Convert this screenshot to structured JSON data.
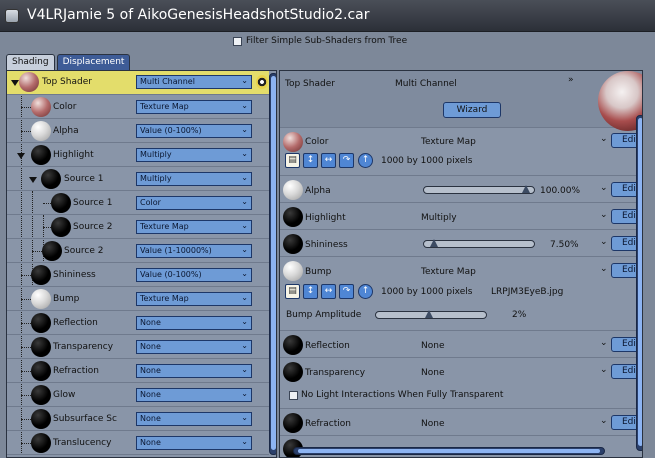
{
  "window": {
    "title": "V4LRJamie 5 of AikoGenesisHeadshotStudio2.car"
  },
  "filter": {
    "label": "Filter Simple Sub-Shaders from Tree",
    "checked": false
  },
  "tabs": [
    {
      "label": "Shading",
      "active": true
    },
    {
      "label": "Displacement",
      "active": false
    }
  ],
  "tree": {
    "rows": [
      {
        "label": "Top Shader",
        "value": "Multi Channel",
        "sphere": "skin",
        "selected": true
      },
      {
        "label": "Color",
        "value": "Texture Map",
        "sphere": "skin"
      },
      {
        "label": "Alpha",
        "value": "Value (0-100%)",
        "sphere": "white"
      },
      {
        "label": "Highlight",
        "value": "Multiply",
        "sphere": "black"
      },
      {
        "label": "Source 1",
        "value": "Multiply",
        "sphere": "black"
      },
      {
        "label": "Source 1",
        "value": "Color",
        "sphere": "black"
      },
      {
        "label": "Source 2",
        "value": "Texture Map",
        "sphere": "black"
      },
      {
        "label": "Source 2",
        "value": "Value (1-10000%)",
        "sphere": "black"
      },
      {
        "label": "Shininess",
        "value": "Value (0-100%)",
        "sphere": "black"
      },
      {
        "label": "Bump",
        "value": "Texture Map",
        "sphere": "white"
      },
      {
        "label": "Reflection",
        "value": "None",
        "sphere": "black"
      },
      {
        "label": "Transparency",
        "value": "None",
        "sphere": "black"
      },
      {
        "label": "Refraction",
        "value": "None",
        "sphere": "black"
      },
      {
        "label": "Glow",
        "value": "None",
        "sphere": "black"
      },
      {
        "label": "Subsurface Sc",
        "value": "None",
        "sphere": "black"
      },
      {
        "label": "Translucency",
        "value": "None",
        "sphere": "black"
      }
    ]
  },
  "props": {
    "top": {
      "label": "Top Shader",
      "value": "Multi Channel",
      "wizard": "Wizard"
    },
    "color": {
      "label": "Color",
      "value": "Texture Map",
      "size": "1000 by 1000 pixels",
      "edit": "Edit"
    },
    "alpha": {
      "label": "Alpha",
      "value": "100.00%",
      "level": 1.0,
      "edit": "Edit"
    },
    "highlight": {
      "label": "Highlight",
      "value": "Multiply",
      "edit": "Edit"
    },
    "shininess": {
      "label": "Shininess",
      "value": "7.50%",
      "level": 0.075,
      "edit": "Edit"
    },
    "bump": {
      "label": "Bump",
      "value": "Texture Map",
      "size": "1000 by 1000 pixels",
      "file": "LRPJM3EyeB.jpg",
      "amplitude_label": "Bump Amplitude",
      "amplitude_value": "2%",
      "amplitude_level": 0.5,
      "edit": "Edit"
    },
    "reflection": {
      "label": "Reflection",
      "value": "None",
      "edit": "Edit"
    },
    "transparency": {
      "label": "Transparency",
      "value": "None",
      "edit": "Edit",
      "no_light_label": "No Light Interactions When Fully Transparent"
    },
    "refraction": {
      "label": "Refraction",
      "value": "None",
      "edit": "Edit"
    }
  }
}
